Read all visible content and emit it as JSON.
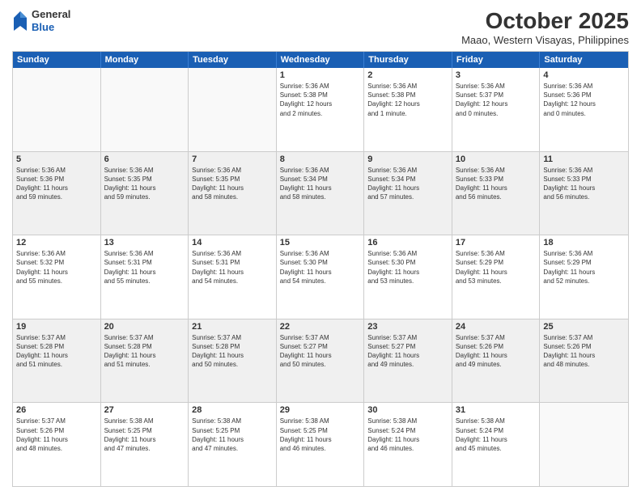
{
  "logo": {
    "general": "General",
    "blue": "Blue"
  },
  "title": "October 2025",
  "subtitle": "Maao, Western Visayas, Philippines",
  "days": [
    "Sunday",
    "Monday",
    "Tuesday",
    "Wednesday",
    "Thursday",
    "Friday",
    "Saturday"
  ],
  "weeks": [
    [
      {
        "day": "",
        "info": ""
      },
      {
        "day": "",
        "info": ""
      },
      {
        "day": "",
        "info": ""
      },
      {
        "day": "1",
        "info": "Sunrise: 5:36 AM\nSunset: 5:38 PM\nDaylight: 12 hours\nand 2 minutes."
      },
      {
        "day": "2",
        "info": "Sunrise: 5:36 AM\nSunset: 5:38 PM\nDaylight: 12 hours\nand 1 minute."
      },
      {
        "day": "3",
        "info": "Sunrise: 5:36 AM\nSunset: 5:37 PM\nDaylight: 12 hours\nand 0 minutes."
      },
      {
        "day": "4",
        "info": "Sunrise: 5:36 AM\nSunset: 5:36 PM\nDaylight: 12 hours\nand 0 minutes."
      }
    ],
    [
      {
        "day": "5",
        "info": "Sunrise: 5:36 AM\nSunset: 5:36 PM\nDaylight: 11 hours\nand 59 minutes."
      },
      {
        "day": "6",
        "info": "Sunrise: 5:36 AM\nSunset: 5:35 PM\nDaylight: 11 hours\nand 59 minutes."
      },
      {
        "day": "7",
        "info": "Sunrise: 5:36 AM\nSunset: 5:35 PM\nDaylight: 11 hours\nand 58 minutes."
      },
      {
        "day": "8",
        "info": "Sunrise: 5:36 AM\nSunset: 5:34 PM\nDaylight: 11 hours\nand 58 minutes."
      },
      {
        "day": "9",
        "info": "Sunrise: 5:36 AM\nSunset: 5:34 PM\nDaylight: 11 hours\nand 57 minutes."
      },
      {
        "day": "10",
        "info": "Sunrise: 5:36 AM\nSunset: 5:33 PM\nDaylight: 11 hours\nand 56 minutes."
      },
      {
        "day": "11",
        "info": "Sunrise: 5:36 AM\nSunset: 5:33 PM\nDaylight: 11 hours\nand 56 minutes."
      }
    ],
    [
      {
        "day": "12",
        "info": "Sunrise: 5:36 AM\nSunset: 5:32 PM\nDaylight: 11 hours\nand 55 minutes."
      },
      {
        "day": "13",
        "info": "Sunrise: 5:36 AM\nSunset: 5:31 PM\nDaylight: 11 hours\nand 55 minutes."
      },
      {
        "day": "14",
        "info": "Sunrise: 5:36 AM\nSunset: 5:31 PM\nDaylight: 11 hours\nand 54 minutes."
      },
      {
        "day": "15",
        "info": "Sunrise: 5:36 AM\nSunset: 5:30 PM\nDaylight: 11 hours\nand 54 minutes."
      },
      {
        "day": "16",
        "info": "Sunrise: 5:36 AM\nSunset: 5:30 PM\nDaylight: 11 hours\nand 53 minutes."
      },
      {
        "day": "17",
        "info": "Sunrise: 5:36 AM\nSunset: 5:29 PM\nDaylight: 11 hours\nand 53 minutes."
      },
      {
        "day": "18",
        "info": "Sunrise: 5:36 AM\nSunset: 5:29 PM\nDaylight: 11 hours\nand 52 minutes."
      }
    ],
    [
      {
        "day": "19",
        "info": "Sunrise: 5:37 AM\nSunset: 5:28 PM\nDaylight: 11 hours\nand 51 minutes."
      },
      {
        "day": "20",
        "info": "Sunrise: 5:37 AM\nSunset: 5:28 PM\nDaylight: 11 hours\nand 51 minutes."
      },
      {
        "day": "21",
        "info": "Sunrise: 5:37 AM\nSunset: 5:28 PM\nDaylight: 11 hours\nand 50 minutes."
      },
      {
        "day": "22",
        "info": "Sunrise: 5:37 AM\nSunset: 5:27 PM\nDaylight: 11 hours\nand 50 minutes."
      },
      {
        "day": "23",
        "info": "Sunrise: 5:37 AM\nSunset: 5:27 PM\nDaylight: 11 hours\nand 49 minutes."
      },
      {
        "day": "24",
        "info": "Sunrise: 5:37 AM\nSunset: 5:26 PM\nDaylight: 11 hours\nand 49 minutes."
      },
      {
        "day": "25",
        "info": "Sunrise: 5:37 AM\nSunset: 5:26 PM\nDaylight: 11 hours\nand 48 minutes."
      }
    ],
    [
      {
        "day": "26",
        "info": "Sunrise: 5:37 AM\nSunset: 5:26 PM\nDaylight: 11 hours\nand 48 minutes."
      },
      {
        "day": "27",
        "info": "Sunrise: 5:38 AM\nSunset: 5:25 PM\nDaylight: 11 hours\nand 47 minutes."
      },
      {
        "day": "28",
        "info": "Sunrise: 5:38 AM\nSunset: 5:25 PM\nDaylight: 11 hours\nand 47 minutes."
      },
      {
        "day": "29",
        "info": "Sunrise: 5:38 AM\nSunset: 5:25 PM\nDaylight: 11 hours\nand 46 minutes."
      },
      {
        "day": "30",
        "info": "Sunrise: 5:38 AM\nSunset: 5:24 PM\nDaylight: 11 hours\nand 46 minutes."
      },
      {
        "day": "31",
        "info": "Sunrise: 5:38 AM\nSunset: 5:24 PM\nDaylight: 11 hours\nand 45 minutes."
      },
      {
        "day": "",
        "info": ""
      }
    ]
  ]
}
